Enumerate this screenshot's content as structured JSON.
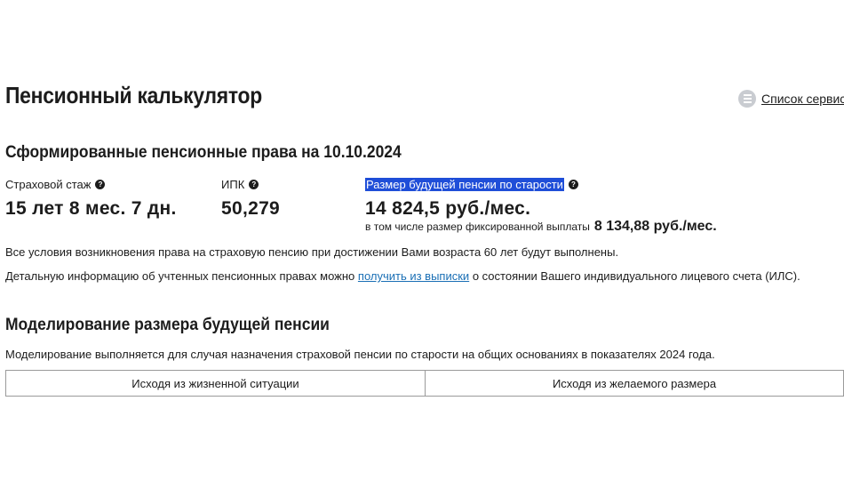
{
  "header": {
    "title": "Пенсионный калькулятор",
    "services_link": "Список сервисов"
  },
  "formed_rights": {
    "title": "Сформированные пенсионные права на 10.10.2024",
    "insurance_period": {
      "label": "Страховой стаж",
      "value": "15 лет 8 мес. 7 дн."
    },
    "ipk": {
      "label": "ИПК",
      "value": "50,279"
    },
    "future_pension": {
      "label": "Размер будущей пенсии по старости",
      "value": "14 824,5 руб./мес.",
      "fixed_note": "в том числе размер фиксированной выплаты",
      "fixed_value": "8 134,88 руб./мес."
    },
    "conditions_text": "Все условия возникновения права на страховую пенсию при достижении Вами возраста 60 лет будут выполнены.",
    "details_text_before": "Детальную информацию об учтенных пенсионных правах можно",
    "details_link": "получить из выписки",
    "details_text_after": "о состоянии Вашего индивидуального лицевого счета (ИЛС)."
  },
  "modeling": {
    "title": "Моделирование размера будущей пенсии",
    "description": "Моделирование выполняется для случая назначения страховой пенсии по старости на общих основаниях в показателях 2024 года.",
    "tabs": [
      "Исходя из жизненной ситуации",
      "Исходя из желаемого размера"
    ]
  },
  "icons": {
    "help": "question-circle-icon",
    "services": "list-menu-icon"
  },
  "colors": {
    "text": "#1c1c1c",
    "link": "#1a6fb5",
    "selection_highlight": "#1f4ed8",
    "services_icon_bg": "#c9ccd1"
  }
}
